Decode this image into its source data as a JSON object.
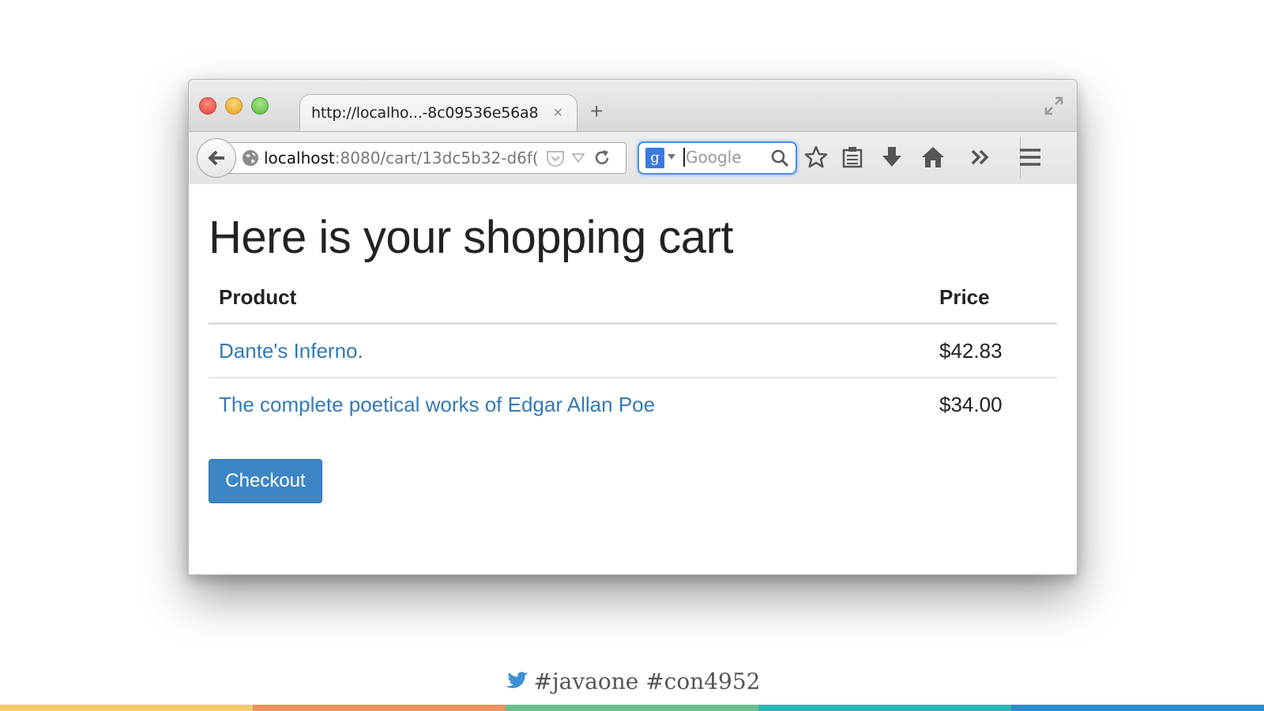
{
  "browser": {
    "tab": {
      "title": "http://localho...-8c09536e56a8",
      "close": "×"
    },
    "new_tab": "+",
    "url": {
      "host": "localhost",
      "rest": ":8080/cart/13dc5b32-d6f("
    },
    "search": {
      "engine_label": "g",
      "placeholder": "Google"
    }
  },
  "page": {
    "title": "Here is your shopping cart",
    "table": {
      "headers": {
        "product": "Product",
        "price": "Price"
      },
      "rows": [
        {
          "product": "Dante's Inferno.",
          "price": "$42.83"
        },
        {
          "product": "The complete poetical works of Edgar Allan Poe",
          "price": "$34.00"
        }
      ]
    },
    "checkout_label": "Checkout"
  },
  "footer": {
    "hashtags": "#javaone #con4952"
  },
  "colors": {
    "link": "#337ab7",
    "button": "#3d86c6",
    "bar": [
      "#f4c96b",
      "#ea9461",
      "#6cc08f",
      "#2fb4b4",
      "#2a8dcb"
    ]
  }
}
